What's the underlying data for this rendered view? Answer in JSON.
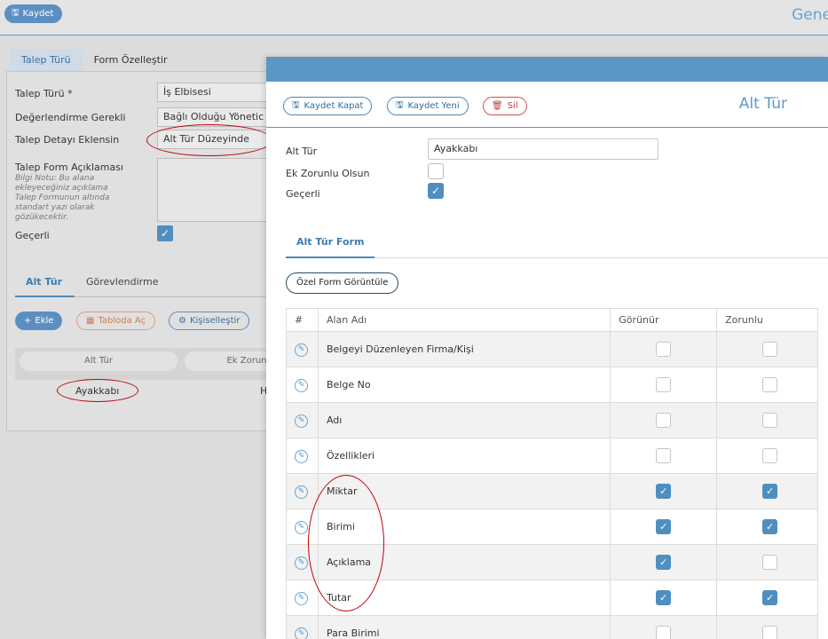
{
  "topbar": {
    "save_label": "Kaydet",
    "page_title": "Gene"
  },
  "tabs": [
    "Talep Türü",
    "Form Özelleştir"
  ],
  "form": {
    "talep_turu_label": "Talep Türü *",
    "talep_turu_value": "İş Elbisesi",
    "degerlendirme_label": "Değerlendirme Gerekli",
    "degerlendirme_value": "Bağlı Olduğu Yönetic",
    "detay_label": "Talep Detayı Eklensin",
    "detay_value": "Alt Tür Düzeyinde",
    "aciklama_label": "Talep Form Açıklaması",
    "aciklama_note": "Bilgi Notu: Bu alana ekleyeceğiniz açıklama Talep Formunun altında standart yazı olarak gözükecektir.",
    "gecerli_label": "Geçerli",
    "gecerli_checked": true
  },
  "subtabs": [
    "Alt Tür",
    "Görevlendirme"
  ],
  "grid_buttons": {
    "ekle": "Ekle",
    "tablo": "Tabloda Aç",
    "kisi": "Kişiselleştir"
  },
  "grid_columns": [
    "Alt Tür",
    "Ek Zorun"
  ],
  "grid_rows": [
    [
      "Ayakkabı",
      "H"
    ]
  ],
  "modal": {
    "buttons": {
      "kaydet_kapat": "Kaydet Kapat",
      "kaydet_yeni": "Kaydet Yeni",
      "sil": "Sil"
    },
    "title": "Alt Tür",
    "fields": {
      "alt_tur_label": "Alt Tür",
      "alt_tur_value": "Ayakkabı",
      "ek_zorunlu_label": "Ek Zorunlu Olsun",
      "ek_zorunlu_checked": false,
      "gecerli_label": "Geçerli",
      "gecerli_checked": true
    },
    "tab": "Alt Tür Form",
    "ozel_form_button": "Özel Form Görüntüle",
    "table": {
      "headers": [
        "#",
        "Alan Adı",
        "Görünür",
        "Zorunlu"
      ],
      "rows": [
        {
          "name": "Belgeyi Düzenleyen Firma/Kişi",
          "gorunur": false,
          "zorunlu": false
        },
        {
          "name": "Belge No",
          "gorunur": false,
          "zorunlu": false
        },
        {
          "name": "Adı",
          "gorunur": false,
          "zorunlu": false
        },
        {
          "name": "Özellikleri",
          "gorunur": false,
          "zorunlu": false
        },
        {
          "name": "Miktar",
          "gorunur": true,
          "zorunlu": true
        },
        {
          "name": "Birimi",
          "gorunur": true,
          "zorunlu": true
        },
        {
          "name": "Açıklama",
          "gorunur": true,
          "zorunlu": false
        },
        {
          "name": "Tutar",
          "gorunur": true,
          "zorunlu": true
        },
        {
          "name": "Para Birimi",
          "gorunur": false,
          "zorunlu": false
        }
      ]
    }
  },
  "colors": {
    "accent": "#5b97c4",
    "danger": "#c23a3a",
    "annotation": "#c0000a"
  }
}
